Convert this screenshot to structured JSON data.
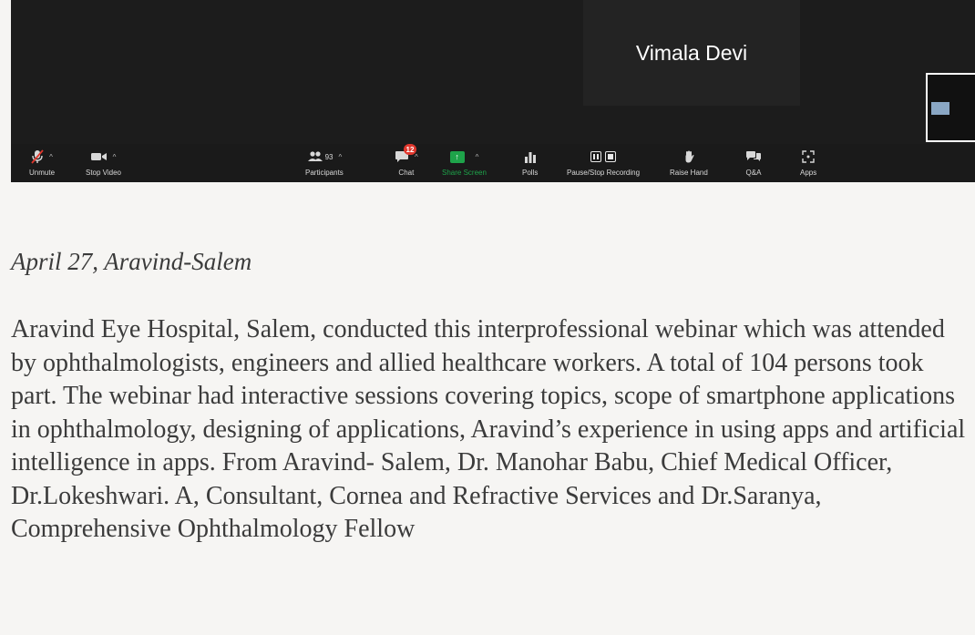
{
  "zoom": {
    "participant_name": "Vimala Devi",
    "toolbar": {
      "unmute": "Unmute",
      "stop_video": "Stop Video",
      "participants": "Participants",
      "participants_count": "93",
      "chat": "Chat",
      "chat_badge": "12",
      "share_screen": "Share Screen",
      "polls": "Polls",
      "recording": "Pause/Stop Recording",
      "raise_hand": "Raise Hand",
      "qa": "Q&A",
      "apps": "Apps"
    },
    "colors": {
      "share_green": "#1ea34a",
      "badge_red": "#e0372d"
    }
  },
  "article": {
    "caption": "April 27, Aravind-Salem",
    "body": "Aravind Eye Hospital, Salem, conducted this interprofessional webinar which was attended by ophthalmologists, engineers and allied healthcare workers. A total of 104 persons took part.  The webinar had interactive sessions covering topics, scope of smartphone applications in ophthalmology, designing of applications, Aravind’s experience in using apps and artificial intelligence in apps. From Aravind- Salem, Dr. Manohar Babu, Chief Medical Officer, Dr.Lokeshwari. A, Consultant, Cornea and Refractive Services and Dr.Saranya, Comprehensive Ophthalmology Fellow"
  }
}
